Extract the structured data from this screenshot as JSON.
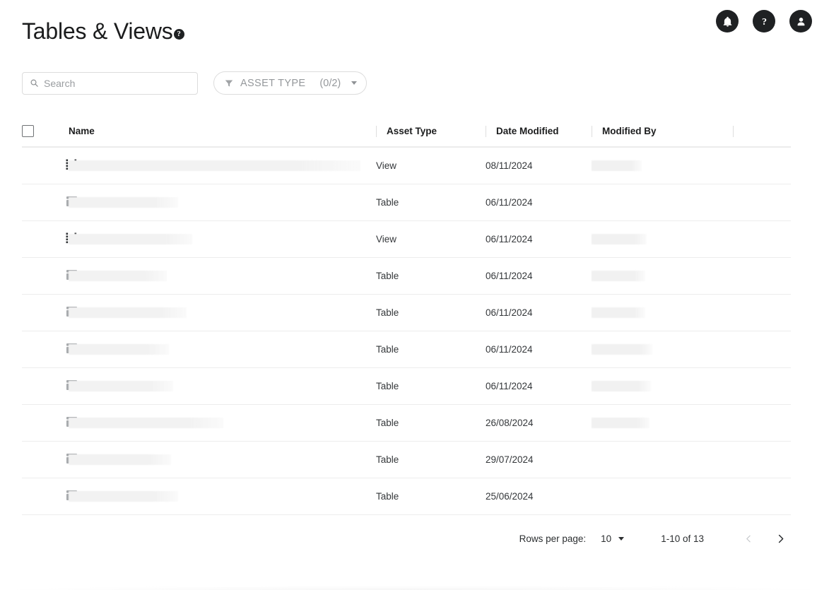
{
  "header": {
    "title": "Tables & Views",
    "help_icon": "help-circle-icon",
    "help_glyph": "?",
    "icons": [
      {
        "name": "notifications-bell-icon",
        "label": "Notifications"
      },
      {
        "name": "help-question-icon",
        "label": "Help"
      },
      {
        "name": "user-account-icon",
        "label": "Account"
      }
    ]
  },
  "toolbar": {
    "search": {
      "icon": "search-icon",
      "placeholder": "Search",
      "value": ""
    },
    "asset_type_filter": {
      "icon": "filter-funnel-icon",
      "label": "ASSET TYPE",
      "count": "(0/2)",
      "caret": "chevron-down-icon"
    }
  },
  "table": {
    "select_all_checkbox": false,
    "columns": [
      {
        "key": "name",
        "label": "Name"
      },
      {
        "key": "asset_type",
        "label": "Asset Type"
      },
      {
        "key": "date_modified",
        "label": "Date Modified"
      },
      {
        "key": "modified_by",
        "label": "Modified By"
      }
    ],
    "rows": [
      {
        "icon": "view-grid-dots-icon",
        "name": "",
        "name_redacted": true,
        "name_width": 413,
        "asset_type": "View",
        "date_modified": "08/11/2024",
        "modified_by": "",
        "modified_by_redacted": true,
        "modified_by_width": 71
      },
      {
        "icon": "table-columns-icon",
        "name": "",
        "name_redacted": true,
        "name_width": 155,
        "asset_type": "Table",
        "date_modified": "06/11/2024",
        "modified_by": "",
        "modified_by_redacted": false,
        "modified_by_width": 0
      },
      {
        "icon": "view-grid-dots-icon",
        "name": "",
        "name_redacted": true,
        "name_width": 175,
        "asset_type": "View",
        "date_modified": "06/11/2024",
        "modified_by": "",
        "modified_by_redacted": true,
        "modified_by_width": 78
      },
      {
        "icon": "table-columns-icon",
        "name": "",
        "name_redacted": true,
        "name_width": 139,
        "asset_type": "Table",
        "date_modified": "06/11/2024",
        "modified_by": "",
        "modified_by_redacted": true,
        "modified_by_width": 76
      },
      {
        "icon": "table-columns-icon",
        "name": "",
        "name_redacted": true,
        "name_width": 167,
        "asset_type": "Table",
        "date_modified": "06/11/2024",
        "modified_by": "",
        "modified_by_redacted": true,
        "modified_by_width": 76
      },
      {
        "icon": "table-columns-icon",
        "name": "",
        "name_redacted": true,
        "name_width": 142,
        "asset_type": "Table",
        "date_modified": "06/11/2024",
        "modified_by": "",
        "modified_by_redacted": true,
        "modified_by_width": 86
      },
      {
        "icon": "table-columns-icon",
        "name": "",
        "name_redacted": true,
        "name_width": 148,
        "asset_type": "Table",
        "date_modified": "06/11/2024",
        "modified_by": "",
        "modified_by_redacted": true,
        "modified_by_width": 84
      },
      {
        "icon": "table-columns-icon",
        "name": "",
        "name_redacted": true,
        "name_width": 219,
        "asset_type": "Table",
        "date_modified": "26/08/2024",
        "modified_by": "",
        "modified_by_redacted": true,
        "modified_by_width": 82
      },
      {
        "icon": "table-columns-icon",
        "name": "",
        "name_redacted": true,
        "name_width": 145,
        "asset_type": "Table",
        "date_modified": "29/07/2024",
        "modified_by": "",
        "modified_by_redacted": false,
        "modified_by_width": 0
      },
      {
        "icon": "table-columns-icon",
        "name": "",
        "name_redacted": true,
        "name_width": 155,
        "asset_type": "Table",
        "date_modified": "25/06/2024",
        "modified_by": "",
        "modified_by_redacted": false,
        "modified_by_width": 0
      }
    ]
  },
  "pagination": {
    "rows_per_page_label": "Rows per page:",
    "rows_per_page_value": "10",
    "range": "1-10 of 13",
    "prev_icon": "chevron-left-icon",
    "next_icon": "chevron-right-icon",
    "prev_enabled": false,
    "next_enabled": true
  },
  "colors": {
    "icon_circle": "#1f2123",
    "text_primary": "#1b1c1d",
    "text_secondary": "#34373a",
    "muted": "#95989b",
    "border": "#dcdcdc",
    "row_border": "#ededed",
    "redact": "#f2f2f2"
  }
}
